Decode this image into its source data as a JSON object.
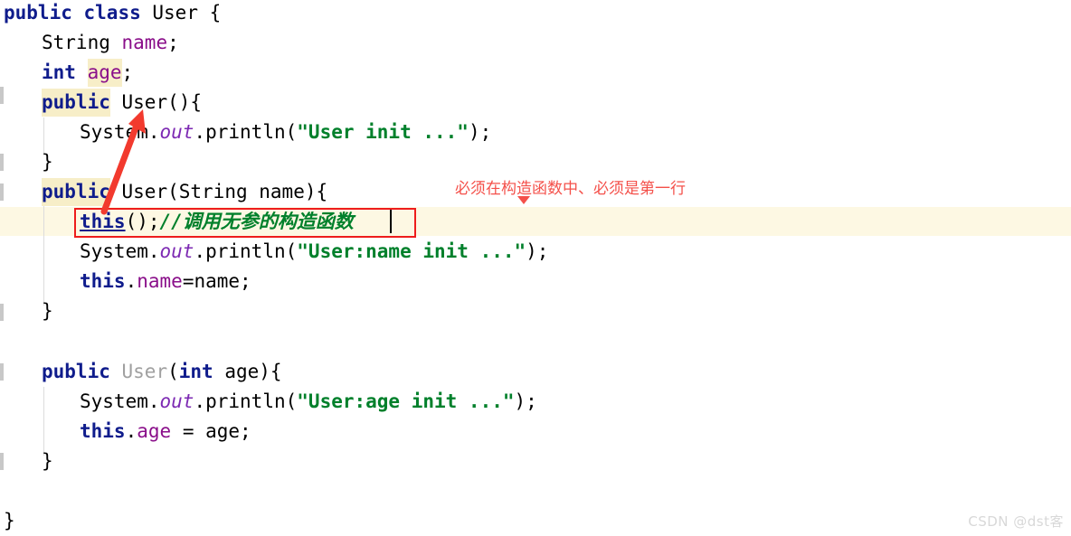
{
  "editor": {
    "language": "java",
    "background_color": "#ffffff",
    "current_line_highlight_color": "#fdf8e3",
    "token_highlight_color": "#f7eec8",
    "lines": [
      {
        "indent": 0,
        "text": "public class User {"
      },
      {
        "indent": 1,
        "text": "String name;"
      },
      {
        "indent": 1,
        "text": "int age;"
      },
      {
        "indent": 1,
        "text": "public User(){"
      },
      {
        "indent": 2,
        "text": "System.out.println(\"User init ...\");"
      },
      {
        "indent": 1,
        "text": "}"
      },
      {
        "indent": 1,
        "text": "public User(String name){"
      },
      {
        "indent": 2,
        "text": "this();//调用无参的构造函数"
      },
      {
        "indent": 2,
        "text": "System.out.println(\"User:name init ...\");"
      },
      {
        "indent": 2,
        "text": "this.name=name;"
      },
      {
        "indent": 1,
        "text": "}"
      },
      {
        "indent": 0,
        "text": ""
      },
      {
        "indent": 1,
        "text": "public User(int age){"
      },
      {
        "indent": 2,
        "text": "System.out.println(\"User:age init ...\");"
      },
      {
        "indent": 2,
        "text": "this.age = age;"
      },
      {
        "indent": 1,
        "text": "}"
      },
      {
        "indent": 0,
        "text": ""
      },
      {
        "indent": 0,
        "text": "}"
      }
    ],
    "tokens": {
      "kw_public": "public",
      "kw_class": "class",
      "kw_int": "int",
      "kw_this": "this",
      "type_string": "String",
      "type_user": "User",
      "field_name": "name",
      "field_age": "age",
      "sys": "System",
      "out": "out",
      "println": "println",
      "str_user_init": "\"User init ...\"",
      "str_user_name_init": "\"User:name init ...\"",
      "str_user_age_init": "\"User:age init ...\"",
      "comment_this": "//调用无参的构造函数"
    }
  },
  "annotation": {
    "text": "必须在构造函数中、必须是第一行",
    "color": "#f4504a",
    "marker": "down-triangle"
  },
  "callout": {
    "box_color": "#ee1c1c",
    "arrow_color": "#f23a2e",
    "arrow_points_from_line": "public User(String name){",
    "arrow_points_to_line": "public User(){"
  },
  "watermark": {
    "text": "CSDN @dst客",
    "color": "#d8d8d8"
  }
}
